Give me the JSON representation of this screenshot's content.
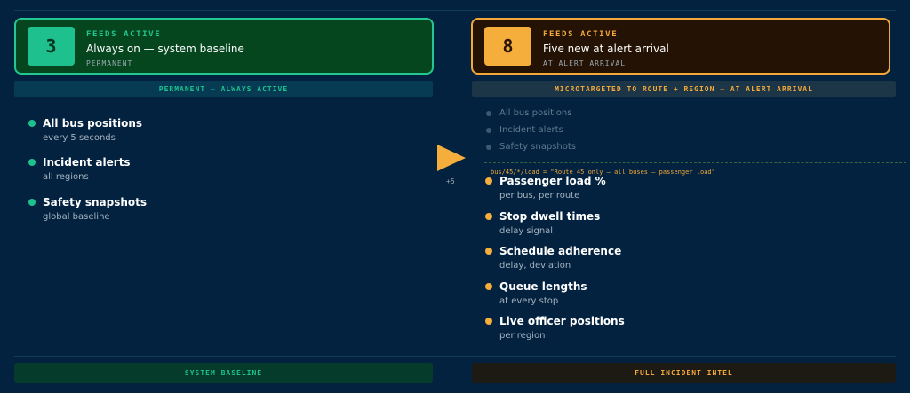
{
  "baseline_card": {
    "count": "3",
    "kicker": "FEEDS ACTIVE",
    "headline": "Always on — system baseline",
    "sub": "PERMANENT"
  },
  "alert_card": {
    "count": "8",
    "kicker": "FEEDS ACTIVE",
    "headline": "Five new at alert arrival",
    "sub": "AT ALERT ARRIVAL"
  },
  "bands": {
    "left": "PERMANENT — ALWAYS ACTIVE",
    "right": "MICROTARGETED TO ROUTE + REGION — AT ALERT ARRIVAL"
  },
  "baseline_feeds": [
    {
      "label": "All bus positions",
      "desc": "every 5 seconds"
    },
    {
      "label": "Incident alerts",
      "desc": "all regions"
    },
    {
      "label": "Safety snapshots",
      "desc": "global baseline"
    }
  ],
  "inherited_feeds": [
    "All bus positions",
    "Incident alerts",
    "Safety snapshots"
  ],
  "transition": {
    "delta": "+5"
  },
  "topic_line": "bus/45/*/load = \"Route 45 only — all buses — passenger load\"",
  "new_feeds": [
    {
      "label": "Passenger load %",
      "desc": "per bus, per route"
    },
    {
      "label": "Stop dwell times",
      "desc": "delay signal"
    },
    {
      "label": "Schedule adherence",
      "desc": "delay, deviation"
    },
    {
      "label": "Queue lengths",
      "desc": "at every stop"
    },
    {
      "label": "Live officer positions",
      "desc": "per region"
    }
  ],
  "footer": {
    "left": "SYSTEM BASELINE",
    "right": "FULL INCIDENT INTEL"
  },
  "colors": {
    "background": "#03223f",
    "baseline_accent": "#1ec08e",
    "alert_accent": "#f5ad3c"
  }
}
